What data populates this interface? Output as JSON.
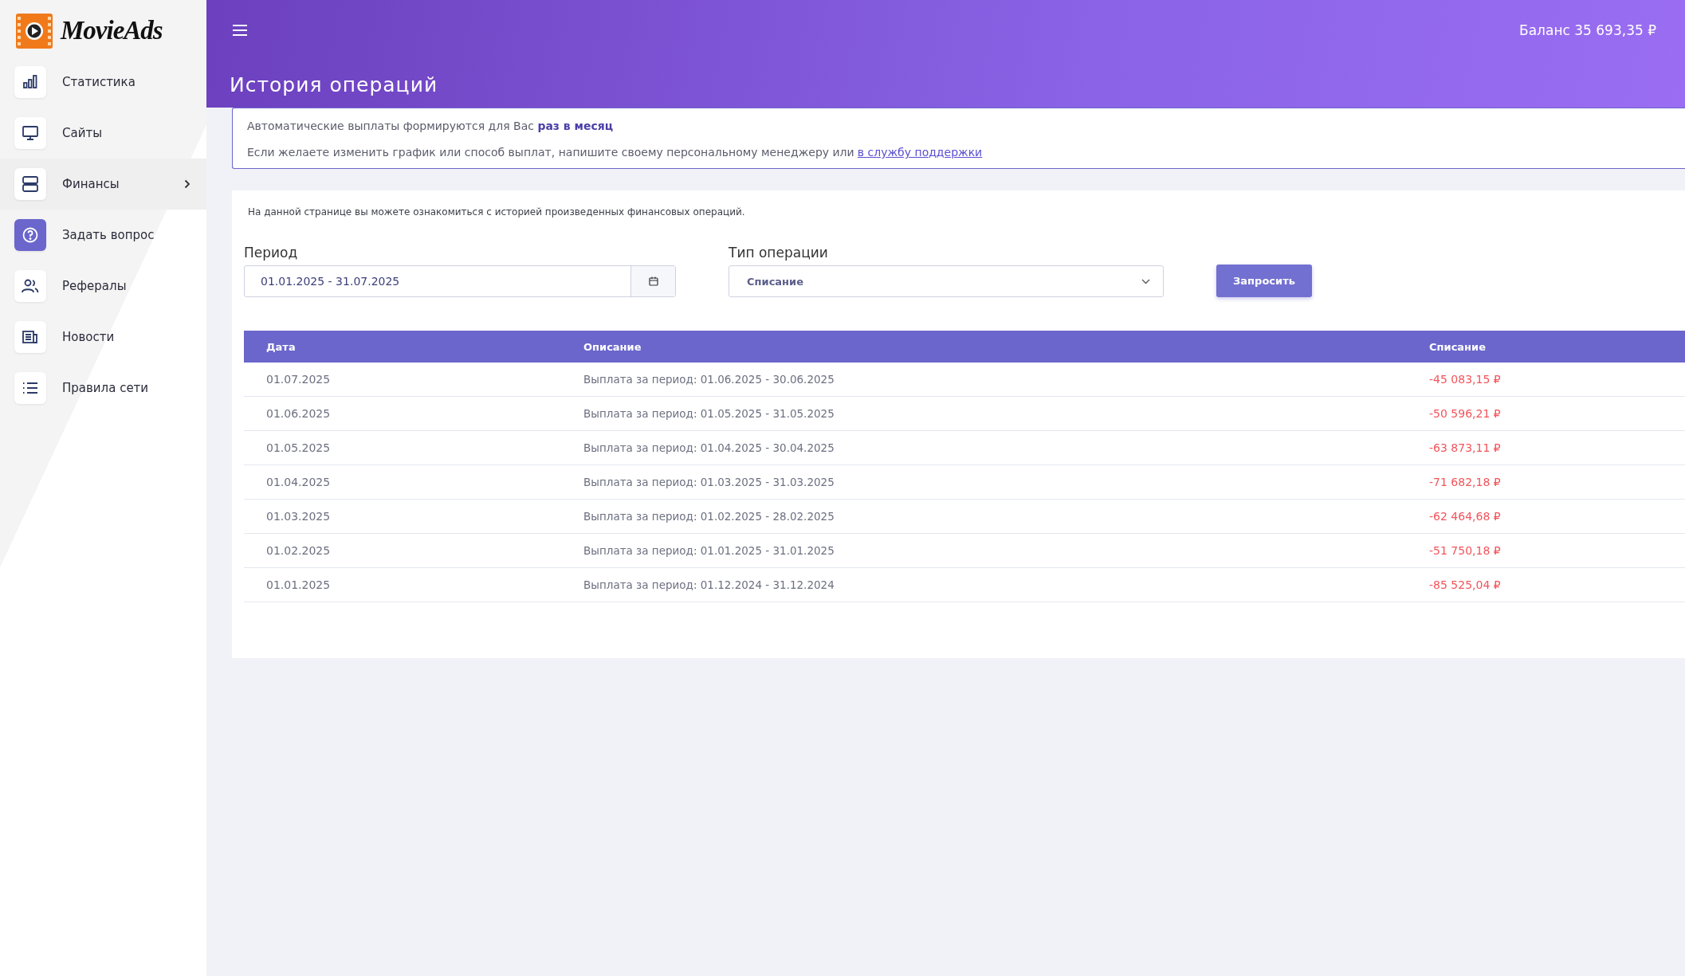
{
  "logo": {
    "text": "MovieAds"
  },
  "sidebar": {
    "items": [
      {
        "label": "Статистика",
        "selected": false,
        "accent": false,
        "submenu": false
      },
      {
        "label": "Сайты",
        "selected": false,
        "accent": false,
        "submenu": false
      },
      {
        "label": "Финансы",
        "selected": true,
        "accent": false,
        "submenu": true
      },
      {
        "label": "Задать вопрос",
        "selected": false,
        "accent": true,
        "submenu": false
      },
      {
        "label": "Рефералы",
        "selected": false,
        "accent": false,
        "submenu": false
      },
      {
        "label": "Новости",
        "selected": false,
        "accent": false,
        "submenu": false
      },
      {
        "label": "Правила сети",
        "selected": false,
        "accent": false,
        "submenu": false
      }
    ]
  },
  "header": {
    "balance": "Баланс 35 693,35  ₽",
    "title": "История операций"
  },
  "notice": {
    "lines": [
      {
        "text": "Автоматические выплаты формируются для Вас **раз в месяц**"
      },
      {
        "text": "Если желаете изменить график или способ выплат, напишите своему персональному менеджеру или",
        "link": "в службу поддержки"
      }
    ]
  },
  "card": {
    "intro": "На данной странице вы можете ознакомиться с историей произведенных финансовых операций.",
    "filters": {
      "period_label": "Период",
      "period_value": "01.01.2025 - 31.07.2025",
      "type_label": "Тип операции",
      "type_value": "Списание",
      "submit": "Запросить"
    },
    "table": {
      "columns": [
        "Дата",
        "Описание",
        "Списание"
      ],
      "rows": [
        [
          "01.07.2025",
          "Выплата за период: 01.06.2025 - 30.06.2025",
          "-45 083,15 ₽"
        ],
        [
          "01.06.2025",
          "Выплата за период: 01.05.2025 - 31.05.2025",
          "-50 596,21 ₽"
        ],
        [
          "01.05.2025",
          "Выплата за период: 01.04.2025 - 30.04.2025",
          "-63 873,11 ₽"
        ],
        [
          "01.04.2025",
          "Выплата за период: 01.03.2025 - 31.03.2025",
          "-71 682,18 ₽"
        ],
        [
          "01.03.2025",
          "Выплата за период: 01.02.2025 - 28.02.2025",
          "-62 464,68 ₽"
        ],
        [
          "01.02.2025",
          "Выплата за период: 01.01.2025 - 31.01.2025",
          "-51 750,18 ₽"
        ],
        [
          "01.01.2025",
          "Выплата за период: 01.12.2024 - 31.12.2024",
          "-85 525,04 ₽"
        ]
      ]
    }
  }
}
